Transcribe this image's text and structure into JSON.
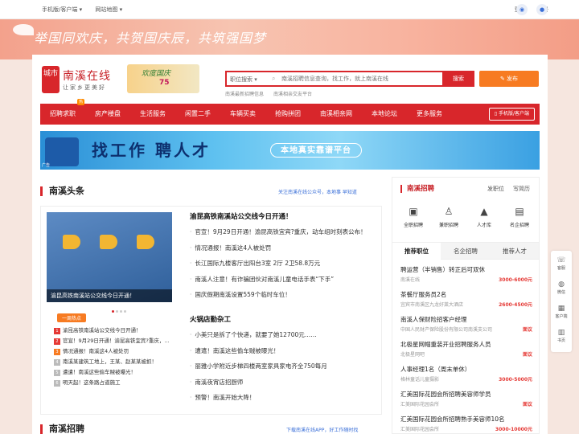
{
  "topbar": {
    "mobile": "手机版/客户端 ▾",
    "sitemap": "网站地图 ▾",
    "login": "登录",
    "register": "注册"
  },
  "banner": {
    "slogan": "举国同欢庆，共贺国庆辰，共筑强国梦"
  },
  "logo": {
    "badge": "城市",
    "name": "南溪在线",
    "slogan": "让家乡更美好"
  },
  "promo": {
    "title": "欢度国庆",
    "number": "75"
  },
  "search": {
    "type": "职位搜索 ▾",
    "placeholder": "南溪招聘信息查询，找工作，就上南溪在线",
    "button": "搜索",
    "hotwords": [
      "南溪最新招聘信息",
      "南溪相亲交友平台"
    ]
  },
  "post_button": "发布",
  "nav": {
    "items": [
      "招聘求职",
      "房产楼盘",
      "生活服务",
      "闲置二手",
      "车辆买卖",
      "抢购拼团",
      "南溪相亲网",
      "本地论坛",
      "更多服务"
    ],
    "hot_badge": "热",
    "app": "手机版/客户端"
  },
  "ad": {
    "main": "找工作 聘人才",
    "sub": "本地真实靠谱平台",
    "mark": "广告"
  },
  "headlines": {
    "title": "南溪头条",
    "note": "关注南溪在线公众号，本地事 早知道",
    "image_caption": "渝昆高铁南溪站公交线今日开通！",
    "hot_tag": "一周热点",
    "hot_list": [
      "渝昆高铁南溪站公交线今日开通！",
      "官宣！9月29日开通！渝昆高铁宜宾?重庆，...",
      "情况通报！南溪这4人被处罚",
      "南溪某建筑工地上，王某、赵某某被抓！",
      "遭遣！南溪这些偷车贼被曝光！",
      "明天起！这条路占道施工"
    ],
    "group1": {
      "head": "渝昆高铁南溪站公交线今日开通！",
      "items": [
        "官宣！9月29日开通！渝昆高铁宜宾?重庆，动车组时刻表公布！",
        "情况通报！南溪这4人被处罚",
        "长江国际九楼客厅出阳台3室 2厅 2卫58.8万元",
        "南溪人注意！有诈骗团伙对南溪儿童电话手表“下手”",
        "国庆假期南溪设置559个临时车位！"
      ]
    },
    "group2": {
      "head": "火锅店勤杂工",
      "items": [
        "小美只是拆了个快递，就要了她12700元……",
        "遭遣！南溪这些偷车贼被曝光！",
        "丽雅小学附近步梯四楼两室家具家电齐全750每月",
        "南溪夜宵店招厨师",
        "预警！南溪开始大降！"
      ]
    }
  },
  "recruit_section": {
    "title": "南溪招聘",
    "note": "下载南溪在线APP，好工作随时找"
  },
  "recruit_panel": {
    "title": "南溪招聘",
    "link_post": "发职位",
    "link_resume": "写简历",
    "icons": [
      "全职招聘",
      "兼职招聘",
      "人才库",
      "名企招聘"
    ],
    "tabs": [
      "推荐职位",
      "名企招聘",
      "推荐人才"
    ],
    "jobs": [
      {
        "title": "聘运营（半销售）转正后可双休",
        "company": "南溪在线",
        "salary": "3000-6000元"
      },
      {
        "title": "茶餐厅服务员2名",
        "company": "宜宾市南溪区九龙好莱大酒店",
        "salary": "2600-4500元"
      },
      {
        "title": "南溪人保财险招客户经理",
        "company": "中国人民财产保险股份有限公司南溪支公司",
        "salary": "面议"
      },
      {
        "title": "北极星网帽重装开业招聘服务人员",
        "company": "北极星网吧",
        "salary": "面议"
      },
      {
        "title": "人事经理1名（周末单休）",
        "company": "格林童话儿童摄影",
        "salary": "3000-5000元"
      },
      {
        "title": "汇美国际花园会所招聘美容师学员",
        "company": "汇美国际花园会所",
        "salary": "面议"
      },
      {
        "title": "汇美国际花园会所招聘熟手美容师10名",
        "company": "汇美国际花园会所",
        "salary": "3000-10000元"
      }
    ]
  },
  "float": [
    "客服",
    "微信",
    "客户端",
    "书页"
  ]
}
